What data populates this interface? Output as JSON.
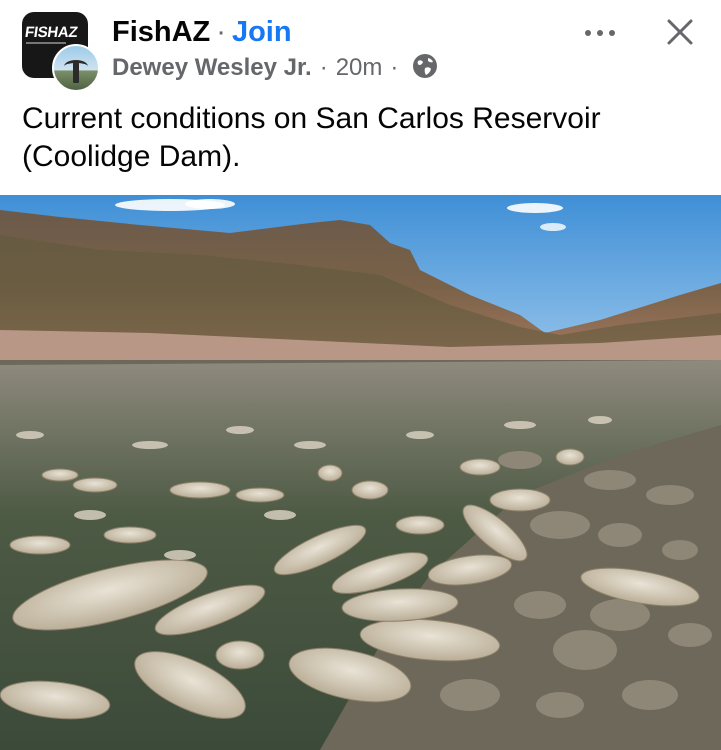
{
  "post": {
    "group_name": "FishAZ",
    "separator": "·",
    "join_label": "Join",
    "author": "Dewey Wesley Jr.",
    "time": "20m",
    "text": "Current conditions on San Carlos Reservoir (Coolidge Dam).",
    "group_logo_text": "FISHAZ"
  },
  "icons": {
    "more": "more-horizontal-icon",
    "close": "close-icon",
    "audience": "globe-icon"
  },
  "colors": {
    "join": "#1877f2",
    "secondary_text": "#65676b",
    "primary_text": "#050505"
  }
}
